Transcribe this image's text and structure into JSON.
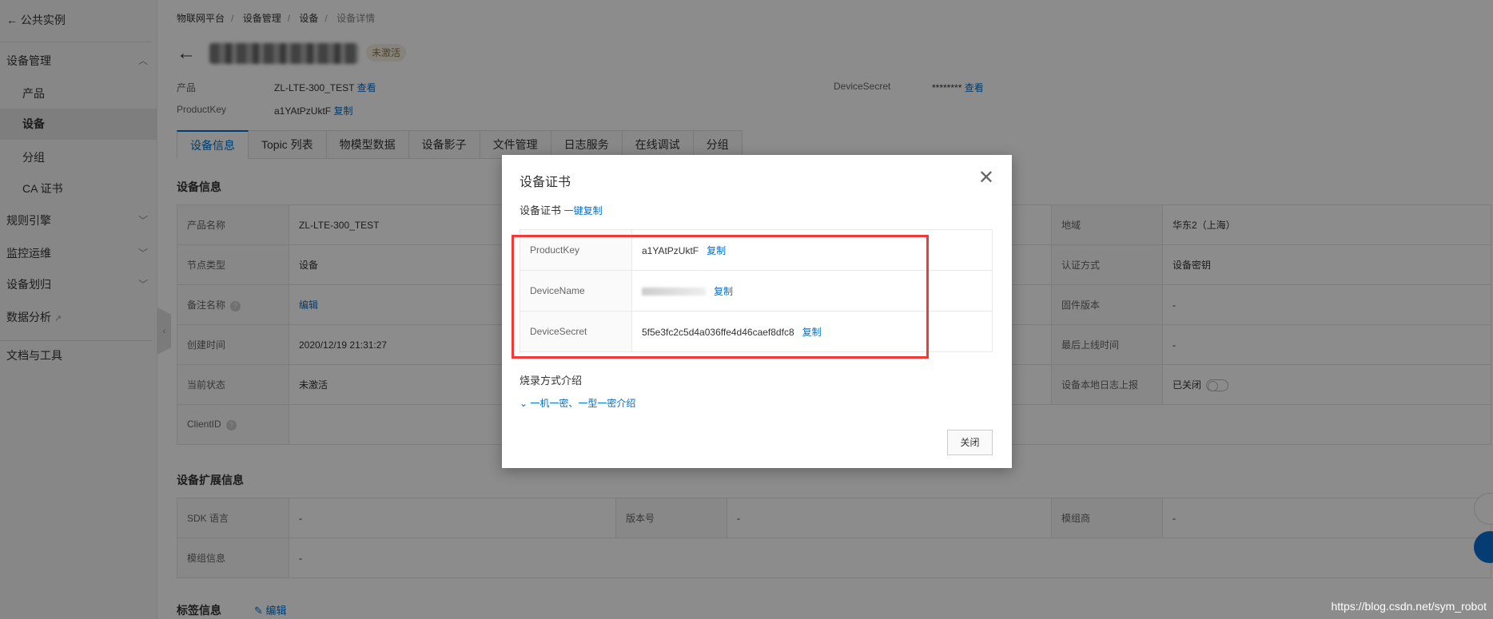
{
  "sidebar": {
    "back": "公共实例",
    "items": [
      {
        "label": "设备管理",
        "chevron": "up"
      },
      {
        "label": "产品"
      },
      {
        "label": "设备",
        "active": true
      },
      {
        "label": "分组"
      },
      {
        "label": "CA 证书"
      },
      {
        "label": "规则引擎",
        "chevron": "down"
      },
      {
        "label": "监控运维",
        "chevron": "down"
      },
      {
        "label": "设备划归",
        "chevron": "down"
      },
      {
        "label": "数据分析",
        "external": true
      },
      {
        "label": "文档与工具"
      }
    ]
  },
  "breadcrumb": [
    "物联网平台",
    "设备管理",
    "设备",
    "设备详情"
  ],
  "header": {
    "status_badge": "未激活",
    "product_label": "产品",
    "product_value": "ZL-LTE-300_TEST",
    "product_link": "查看",
    "pk_label": "ProductKey",
    "pk_value": "a1YAtPzUktF",
    "pk_link": "复制",
    "secret_label": "DeviceSecret",
    "secret_value": "********",
    "secret_link": "查看"
  },
  "tabs": [
    "设备信息",
    "Topic 列表",
    "物模型数据",
    "设备影子",
    "文件管理",
    "日志服务",
    "在线调试",
    "分组"
  ],
  "device_info": {
    "title": "设备信息",
    "rows": [
      {
        "l1": "产品名称",
        "v1": "ZL-LTE-300_TEST",
        "l3": "地域",
        "v3": "华东2（上海）"
      },
      {
        "l1": "节点类型",
        "v1": "设备",
        "l3": "认证方式",
        "v3": "设备密钥"
      },
      {
        "l1": "备注名称",
        "v1": "编辑",
        "l3": "固件版本",
        "v3": "-"
      },
      {
        "l1": "创建时间",
        "v1": "2020/12/19 21:31:27",
        "l3": "最后上线时间",
        "v3": "-"
      },
      {
        "l1": "当前状态",
        "v1": "未激活",
        "l3": "设备本地日志上报",
        "v3": "已关闭"
      },
      {
        "l1": "ClientID",
        "v1": "",
        "l3": "",
        "v3": ""
      }
    ]
  },
  "ext_info": {
    "title": "设备扩展信息",
    "row1": [
      "SDK 语言",
      "-",
      "版本号",
      "-",
      "模组商",
      "-"
    ],
    "row2": [
      "模组信息",
      "-"
    ]
  },
  "tags": {
    "title": "标签信息",
    "edit": "编辑"
  },
  "modal": {
    "title": "设备证书",
    "subtitle": "设备证书",
    "copy_all": "一键复制",
    "rows": [
      {
        "label": "ProductKey",
        "value": "a1YAtPzUktF",
        "copy": "复制"
      },
      {
        "label": "DeviceName",
        "value": "",
        "copy": "复制"
      },
      {
        "label": "DeviceSecret",
        "value": "5f5e3fc2c5d4a036ffe4d46caef8dfc8",
        "copy": "复制"
      }
    ],
    "burn_title": "烧录方式介绍",
    "burn_link": "一机一密、一型一密介绍",
    "close_button": "关闭"
  },
  "watermark": "https://blog.csdn.net/sym_robot",
  "colors": {
    "accent": "#0070cc",
    "highlight_box": "#f03a3a"
  }
}
